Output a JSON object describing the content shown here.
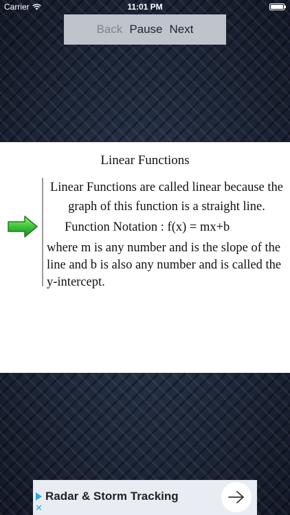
{
  "status_bar": {
    "carrier": "Carrier",
    "time": "11:01 PM"
  },
  "controls": {
    "back": "Back",
    "pause": "Pause",
    "next": "Next"
  },
  "lesson": {
    "title": "Linear Functions",
    "paragraph1": "Linear Functions are called linear because the graph of this function is a straight line.",
    "formula": "Function Notation : f(x) = mx+b",
    "paragraph2": "where m is any number and is the slope of the line and b is also any number and is called the y-intercept."
  },
  "ad": {
    "title": "Radar & Storm Tracking",
    "close": "✕"
  },
  "colors": {
    "accent_ad": "#28a8e0",
    "arrow_green": "#3cc43a",
    "control_bar_bg": "#bfc4cc"
  },
  "icons": [
    "wifi-icon",
    "battery-icon",
    "green-arrow-icon",
    "ad-play-icon",
    "ad-close-icon",
    "arrow-right-icon"
  ]
}
